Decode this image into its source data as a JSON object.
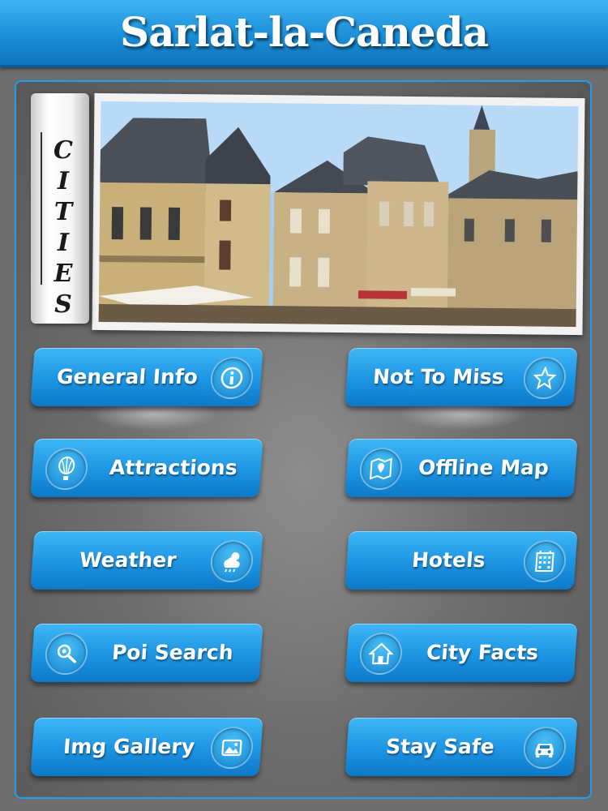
{
  "header": {
    "title": "Sarlat-la-Caneda"
  },
  "banner": {
    "scroll_text": "CITIES"
  },
  "menu": {
    "general_info": "General Info",
    "not_to_miss": "Not To Miss",
    "attractions": "Attractions",
    "offline_map": "Offline Map",
    "weather": "Weather",
    "hotels": "Hotels",
    "poi_search": "Poi Search",
    "city_facts": "City Facts",
    "img_gallery": "Img Gallery",
    "stay_safe": "Stay Safe"
  },
  "icons": {
    "general_info": "info-icon",
    "not_to_miss": "star-icon",
    "attractions": "balloon-icon",
    "offline_map": "map-icon",
    "weather": "weather-icon",
    "hotels": "building-icon",
    "poi_search": "search-icon",
    "city_facts": "home-icon",
    "img_gallery": "gallery-icon",
    "stay_safe": "car-icon"
  },
  "colors": {
    "accent": "#1d94e2",
    "background": "#6e6e6e"
  }
}
